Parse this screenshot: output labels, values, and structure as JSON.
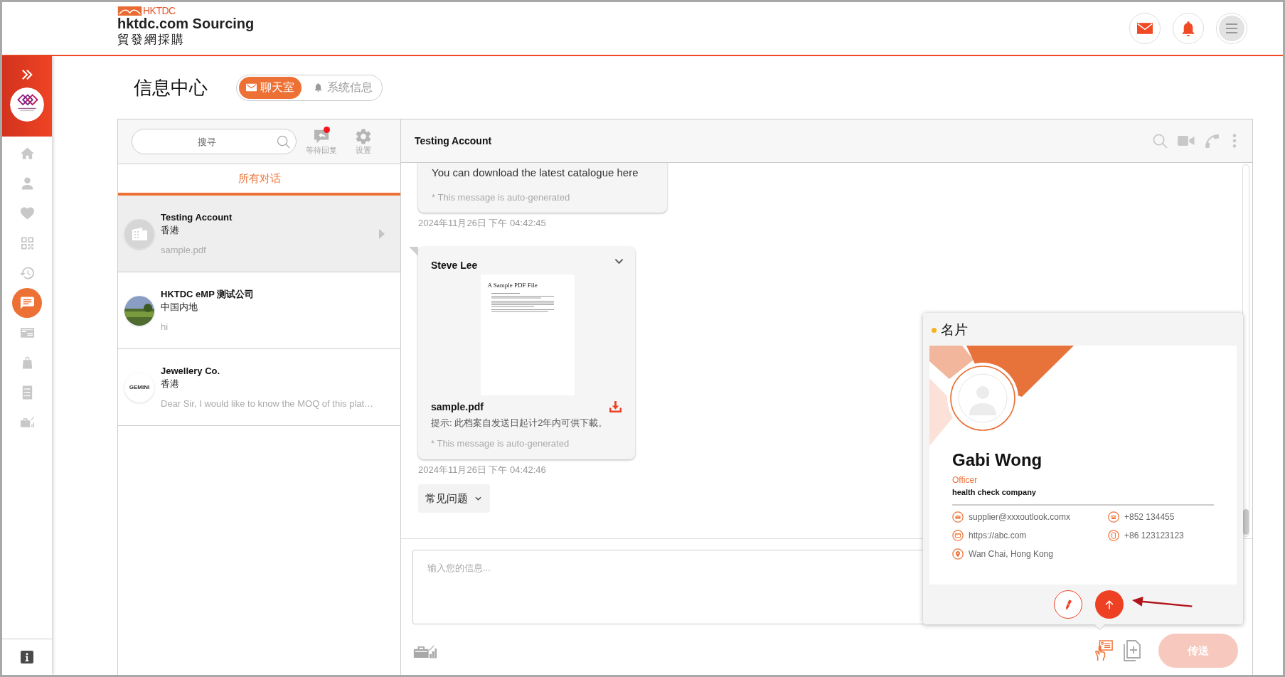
{
  "header": {
    "logo_text": "HKTDC",
    "site_name": "hktdc.com Sourcing",
    "site_name_zh": "貿發網採購"
  },
  "sidebar": {
    "items": [
      {
        "selected": false
      },
      {
        "selected": false
      },
      {
        "selected": false
      },
      {
        "selected": false
      },
      {
        "selected": false
      },
      {
        "selected": true
      },
      {
        "selected": false
      },
      {
        "selected": false
      },
      {
        "selected": false
      },
      {
        "selected": false
      }
    ]
  },
  "page_title": "信息中心",
  "mode_tabs": [
    {
      "label": "聊天室",
      "selected": true
    },
    {
      "label": "系统信息",
      "selected": false
    }
  ],
  "conversations_panel": {
    "search": {
      "placeholder": "搜寻"
    },
    "tools": [
      {
        "label": "等待回复",
        "unread": true
      },
      {
        "label": "设置",
        "unread": false
      }
    ],
    "filter_tabs": [
      {
        "label": "所有对话",
        "selected": true
      }
    ],
    "conversations": [
      {
        "name": "Testing Account",
        "region": "香港",
        "preview": "sample.pdf",
        "selected": true,
        "avatar": {
          "kind": "placeholder"
        }
      },
      {
        "name": "HKTDC eMP 测试公司",
        "region": "中国内地",
        "preview": "hi",
        "selected": false,
        "avatar": {
          "kind": "photo"
        }
      },
      {
        "name": "Jewellery Co.",
        "region": "香港",
        "preview": "Dear Sir, I would like to know the MOQ of this plat…",
        "selected": false,
        "avatar": {
          "kind": "logo",
          "text": "GEMINI"
        }
      }
    ]
  },
  "chat": {
    "title": "Testing Account",
    "messages": [
      {
        "kind": "text",
        "body": "You can download the latest catalogue here",
        "note": "* This message is auto-generated",
        "time": "2024年11月26日 下午 04:42:45"
      },
      {
        "kind": "file",
        "sender": "Steve Lee",
        "preview_title": "A Sample PDF File",
        "file_name": "sample.pdf",
        "hint": "提示: 此档案自发送日起计2年内可供下載。",
        "note": "* This message is auto-generated",
        "time": "2024年11月26日 下午 04:42:46"
      }
    ],
    "quick_reply": {
      "label": "常见问题"
    },
    "composer": {
      "placeholder": "输入您的信息...",
      "tools": [
        {
          "selected": false
        },
        {
          "selected": true
        },
        {
          "selected": false
        }
      ],
      "send": {
        "label": "传送",
        "disabled": true
      }
    }
  },
  "business_card_popup": {
    "title": "名片",
    "name": "Gabi Wong",
    "position": "Officer",
    "company": "health check company",
    "contacts": [
      {
        "kind": "email",
        "value": "supplier@xxxoutlook.comx"
      },
      {
        "kind": "phone",
        "value": "+852 134455"
      },
      {
        "kind": "web",
        "value": "https://abc.com"
      },
      {
        "kind": "mobile",
        "value": "+86 123123123"
      },
      {
        "kind": "location",
        "value": "Wan Chai, Hong Kong"
      }
    ]
  }
}
